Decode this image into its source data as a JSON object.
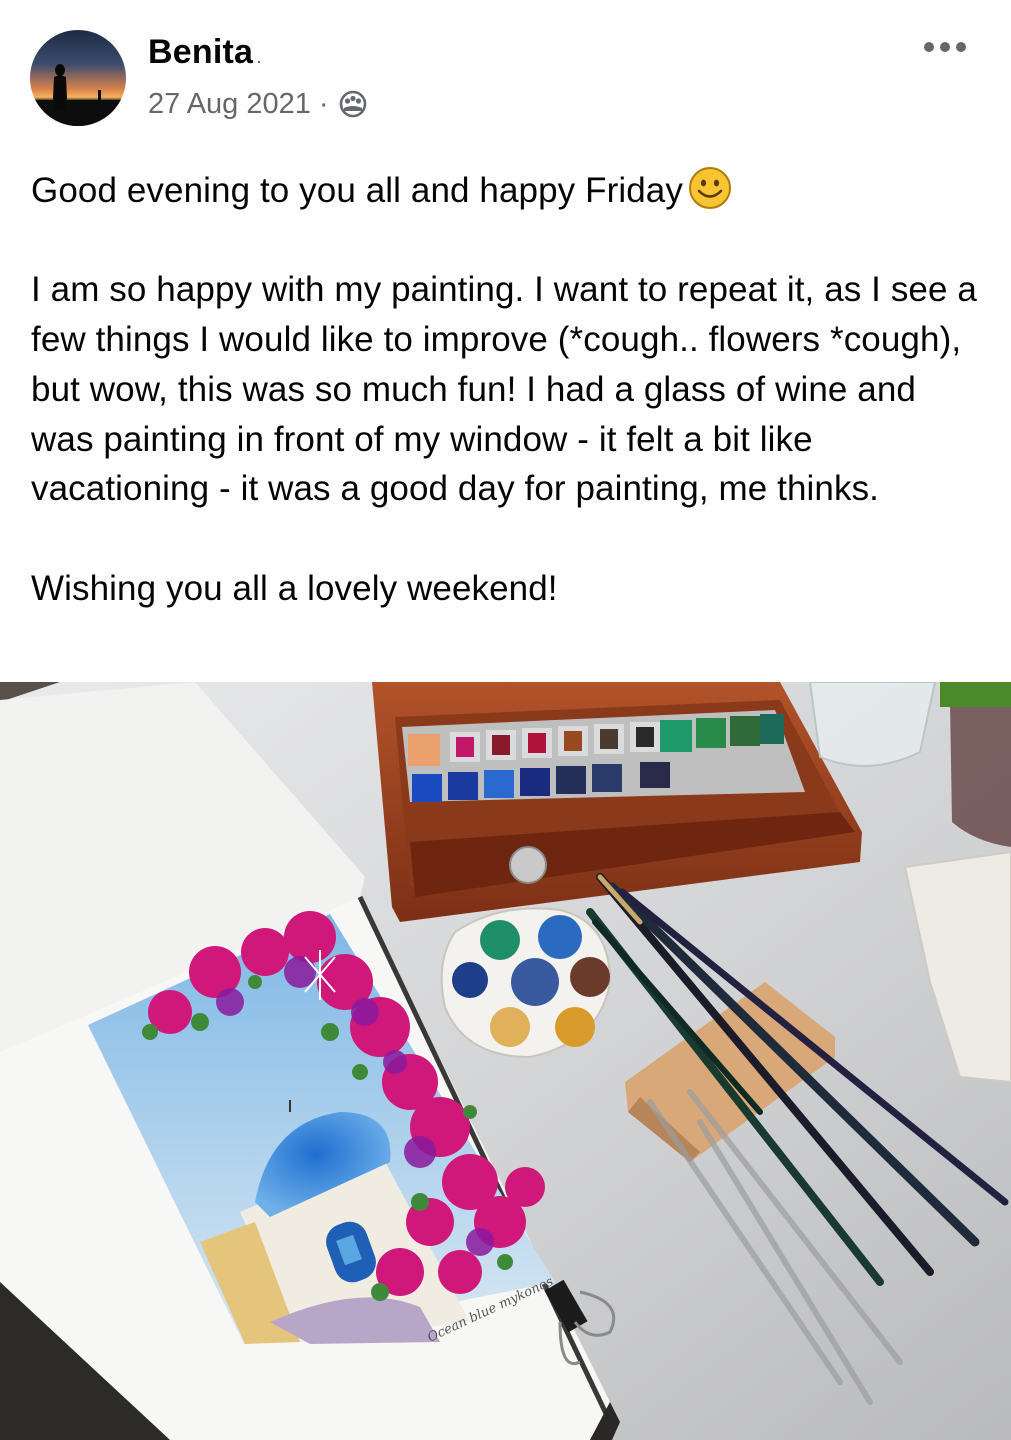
{
  "post": {
    "author": "Benita",
    "author_suffix": ".",
    "date": "27 Aug 2021",
    "separator": "·",
    "audience_icon": "group-audience-icon",
    "more_icon": "more-options-icon",
    "paragraphs": [
      "Good evening to you all and happy Friday",
      "I am so happy with my painting. I want to repeat it, as I see a few things I would like to improve (*cough.. flowers *cough), but wow, this was so much fun! I had a glass of wine and was painting in front of my window - it felt a bit like vacationing - it was a good day for painting, me thinks.",
      "Wishing you all a lovely weekend!"
    ],
    "emoji": "smiling-face-emoji",
    "photo": {
      "description_icon": "watercolor-painting-photo",
      "signature_text": "Ocean blue mykonos"
    }
  }
}
